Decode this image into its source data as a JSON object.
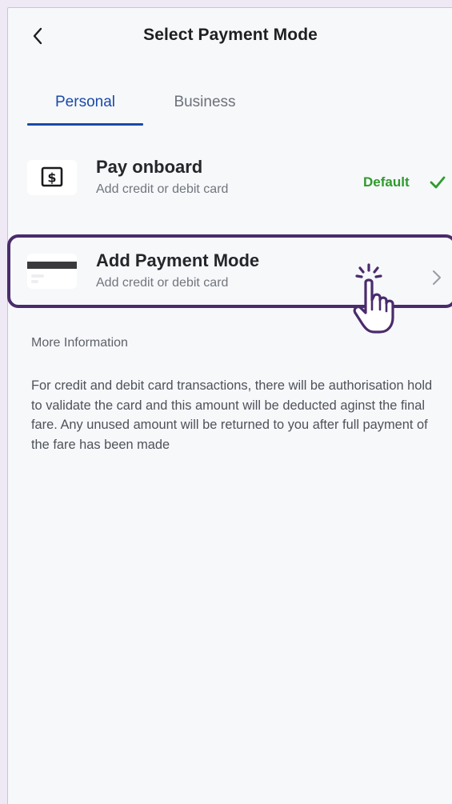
{
  "header": {
    "title": "Select Payment Mode",
    "back_icon": "chevron-left-icon"
  },
  "tabs": [
    {
      "label": "Personal",
      "selected": true
    },
    {
      "label": "Business",
      "selected": false
    }
  ],
  "payment_options": [
    {
      "title": "Pay onboard",
      "subtitle": "Add credit or debit card",
      "icon": "cash-dollar-icon",
      "badge": "Default",
      "badge_icon": "checkmark-icon"
    },
    {
      "title": "Add Payment Mode",
      "subtitle": "Add credit or debit card",
      "icon": "credit-card-icon",
      "trailing_icon": "chevron-right-icon"
    }
  ],
  "info": {
    "heading": "More Information",
    "body": "For credit and debit card transactions, there will be authorisation hold to validate the card and this amount will be deducted aginst the final fare. Any unused amount will be returned to you after full payment of the fare has been made"
  },
  "colors": {
    "accent": "#1b4aa8",
    "success": "#2f9a2c",
    "highlight": "#4a2b6b",
    "background": "#f6f8fa",
    "outer": "#efe9f6"
  }
}
